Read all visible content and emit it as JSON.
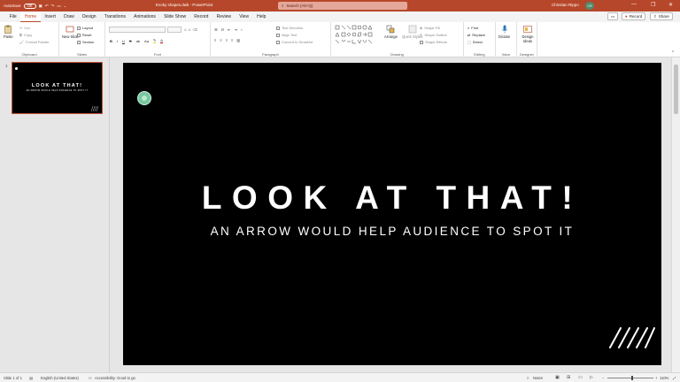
{
  "titlebar": {
    "autosave_label": "AutoSave",
    "autosave_state": "Off",
    "doc_name": "Evoky shapes.dwk  -  PowerPoint",
    "search_placeholder": "Search (Alt+Q)",
    "user_name": "Christian Rippo",
    "user_initials": "CR",
    "minimize": "—",
    "restore": "❐",
    "close": "✕"
  },
  "tabs": [
    "File",
    "Home",
    "Insert",
    "Draw",
    "Design",
    "Transitions",
    "Animations",
    "Slide Show",
    "Record",
    "Review",
    "View",
    "Help"
  ],
  "tab_actions": {
    "comments": "Comments",
    "record": "Record",
    "share": "Share"
  },
  "ribbon": {
    "clipboard": {
      "label": "Clipboard",
      "paste": "Paste",
      "cut": "Cut",
      "copy": "Copy",
      "format_painter": "Format Painter"
    },
    "slides": {
      "label": "Slides",
      "new_slide": "New Slide",
      "layout": "Layout",
      "reset": "Reset",
      "section": "Section"
    },
    "font": {
      "label": "Font"
    },
    "paragraph": {
      "label": "Paragraph",
      "text_direction": "Text Direction",
      "align_text": "Align Text",
      "convert_smartart": "Convert to SmartArt"
    },
    "drawing": {
      "label": "Drawing",
      "arrange": "Arrange",
      "quick_styles": "Quick Styles",
      "shape_fill": "Shape Fill",
      "shape_outline": "Shape Outline",
      "shape_effects": "Shape Effects"
    },
    "editing": {
      "label": "Editing",
      "find": "Find",
      "replace": "Replace",
      "select": "Select"
    },
    "voice": {
      "label": "Voice",
      "dictate": "Dictate"
    },
    "designer": {
      "label": "Designer",
      "design_ideas": "Design Ideas"
    }
  },
  "thumbnails": [
    {
      "number": "1",
      "title": "LOOK AT THAT!",
      "subtitle": "AN ARROW WOULD HELP AUDIENCE TO SPOT IT"
    }
  ],
  "slide": {
    "title": "LOOK AT THAT!",
    "subtitle": "AN ARROW WOULD HELP AUDIENCE TO SPOT IT",
    "background_color": "#000000",
    "marker_color": "#79c79f"
  },
  "statusbar": {
    "slide_count": "Slide 1 of 1",
    "language": "English (United States)",
    "accessibility": "Accessibility: Good to go",
    "notes": "Notes",
    "zoom": "110%"
  },
  "colors": {
    "accent": "#b7472a",
    "ribbon_bg": "#ffffff",
    "workspace": "#e6e6e6"
  }
}
